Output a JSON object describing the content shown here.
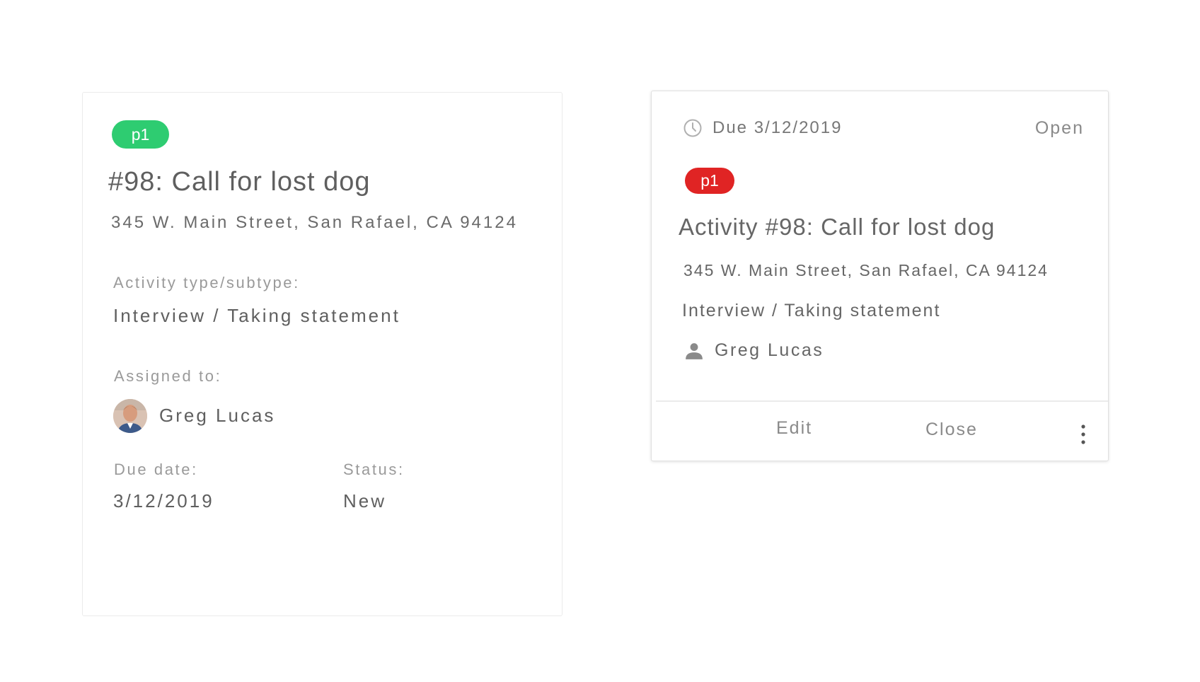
{
  "left_card": {
    "priority": "p1",
    "priority_color": "#2ecc71",
    "title": "#98: Call for lost dog",
    "address": "345 W. Main Street, San Rafael, CA 94124",
    "type_label": "Activity type/subtype:",
    "type_value": "Interview / Taking statement",
    "assigned_label": "Assigned to:",
    "assignee": "Greg Lucas",
    "due_label": "Due date:",
    "due_value": "3/12/2019",
    "status_label": "Status:",
    "status_value": "New"
  },
  "right_card": {
    "due": "Due 3/12/2019",
    "status": "Open",
    "priority": "p1",
    "priority_color": "#e02424",
    "title": "Activity #98: Call for lost dog",
    "address": "345 W. Main Street, San Rafael, CA 94124",
    "type_value": "Interview / Taking statement",
    "assignee": "Greg Lucas",
    "actions": {
      "edit": "Edit",
      "close": "Close"
    },
    "icons": {
      "due": "clock-icon",
      "assignee": "person-icon",
      "more": "more-vertical-icon"
    }
  }
}
